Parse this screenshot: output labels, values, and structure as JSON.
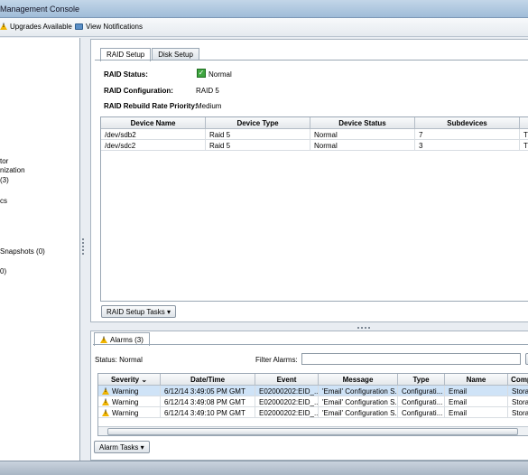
{
  "window": {
    "title": "Management Console"
  },
  "toolbar": {
    "upgrades_label": "Upgrades Available",
    "notifications_label": "View Notifications"
  },
  "left_tree": {
    "items": [
      {
        "label": "tor"
      },
      {
        "label": "nization"
      },
      {
        "label": "(3)"
      },
      {
        "label": "cs"
      },
      {
        "label": "Snapshots (0)"
      },
      {
        "label": "0)"
      }
    ]
  },
  "raid_panel": {
    "tabs": [
      {
        "label": "RAID Setup"
      },
      {
        "label": "Disk Setup"
      }
    ],
    "status_label": "RAID Status:",
    "status_value": "Normal",
    "config_label": "RAID Configuration:",
    "config_value": "RAID 5",
    "priority_label": "RAID Rebuild Rate Priority:",
    "priority_value": "Medium",
    "columns": [
      "Device Name",
      "Device Type",
      "Device Status",
      "Subdevices",
      "Ti"
    ],
    "rows": [
      [
        "/dev/sdb2",
        "Raid 5",
        "Normal",
        "7",
        "Ti"
      ],
      [
        "/dev/sdc2",
        "Raid 5",
        "Normal",
        "3",
        "Ti"
      ]
    ],
    "tasks_button": "RAID Setup Tasks ▾"
  },
  "alarms_panel": {
    "tab_label": "Alarms (3)",
    "status_text": "Status:  Normal",
    "filter_label": "Filter Alarms:",
    "filter_value": "",
    "columns": [
      "Severity",
      "Date/Time",
      "Event",
      "Message",
      "Type",
      "Name",
      "Comp"
    ],
    "rows": [
      [
        "Warning",
        "6/12/14 3:49:05 PM GMT",
        "E02000202:EID_...",
        "'Email' Configuration S...",
        "Configurati...",
        "Email",
        "Storag"
      ],
      [
        "Warning",
        "6/12/14 3:49:08 PM GMT",
        "E02000202:EID_...",
        "'Email' Configuration S...",
        "Configurati...",
        "Email",
        "Storag"
      ],
      [
        "Warning",
        "6/12/14 3:49:10 PM GMT",
        "E02000202:EID_...",
        "'Email' Configuration S...",
        "Configurati...",
        "Email",
        "Storag"
      ]
    ],
    "tasks_button": "Alarm Tasks ▾"
  },
  "colors": {
    "selected_row": "#cfe3f7",
    "status_ok": "#3fa640",
    "warning": "#f0b400"
  }
}
